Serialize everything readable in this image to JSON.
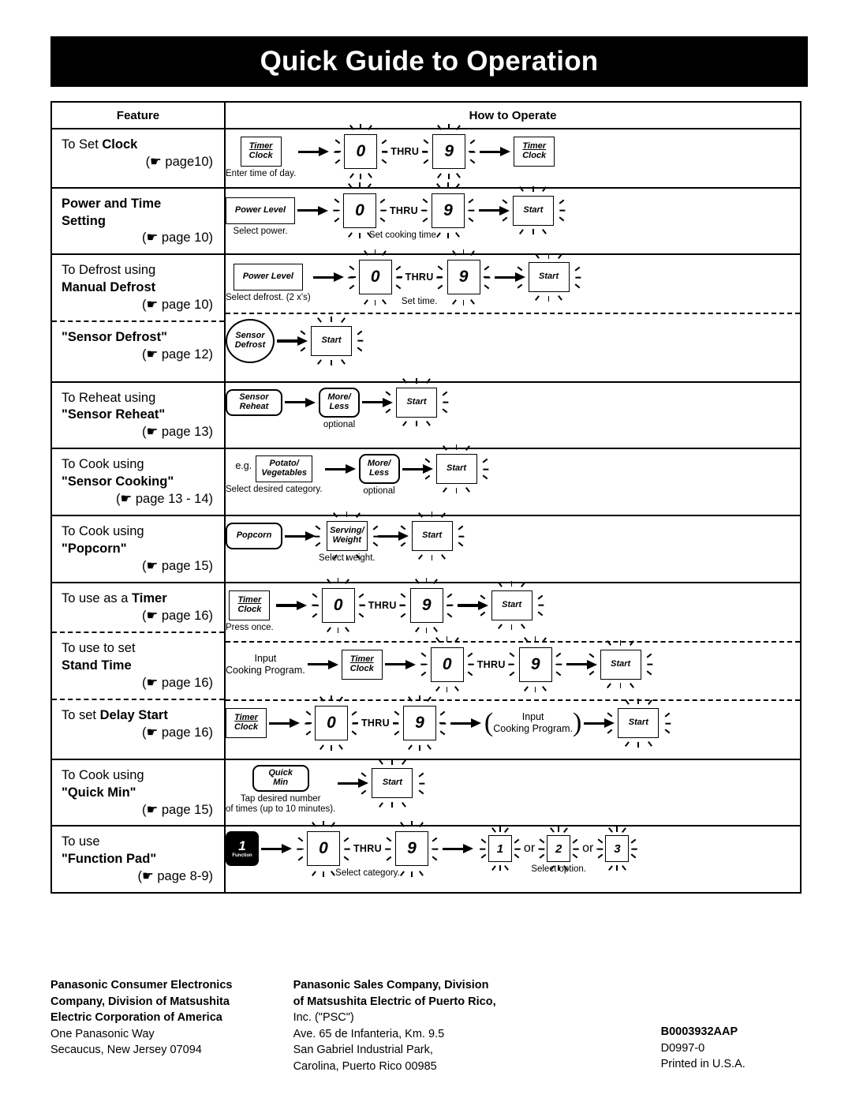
{
  "banner": {
    "title": "Quick Guide to Operation"
  },
  "table": {
    "headers": {
      "feature": "Feature",
      "how_to_operate": "How to Operate"
    },
    "labels": {
      "thru": "THRU",
      "or": "or",
      "eg": "e.g.",
      "optional": "optional"
    },
    "rows": [
      {
        "id": "set-clock",
        "feature": {
          "line1": "To Set ",
          "line1_bold": "Clock",
          "page": "(☛ page10)"
        },
        "steps": [
          {
            "type": "key",
            "label_lines": [
              "Timer",
              "Clock"
            ],
            "shape": "rect-sm",
            "underline_first": true,
            "caption": "Enter time of day."
          },
          {
            "type": "arrow"
          },
          {
            "type": "numrange",
            "from": "0",
            "to": "9",
            "caption": ""
          },
          {
            "type": "arrow"
          },
          {
            "type": "key",
            "label_lines": [
              "Timer",
              "Clock"
            ],
            "shape": "rect-sm",
            "underline_first": true,
            "caption": ""
          }
        ]
      },
      {
        "id": "power-and-time",
        "feature": {
          "line1_bold": "Power and Time",
          "line2_bold": "Setting",
          "page": "(☛ page 10)"
        },
        "steps": [
          {
            "type": "key",
            "label_lines": [
              "Power Level"
            ],
            "shape": "rect-wide",
            "caption": "Select power."
          },
          {
            "type": "arrow"
          },
          {
            "type": "numrange",
            "from": "0",
            "to": "9",
            "caption": "Set cooking time."
          },
          {
            "type": "arrow"
          },
          {
            "type": "key",
            "label_lines": [
              "Start"
            ],
            "shape": "rect-sm",
            "flashing": true,
            "caption": ""
          }
        ]
      },
      {
        "id": "manual-defrost",
        "feature": {
          "line1": "To Defrost using",
          "line2_bold": "Manual Defrost",
          "page": "(☛ page 10)"
        },
        "steps": [
          {
            "type": "key",
            "label_lines": [
              "Power Level"
            ],
            "shape": "rect-wide",
            "caption": "Select defrost. (2 x's)"
          },
          {
            "type": "arrow"
          },
          {
            "type": "numrange",
            "from": "0",
            "to": "9",
            "caption": "Set time."
          },
          {
            "type": "arrow"
          },
          {
            "type": "key",
            "label_lines": [
              "Start"
            ],
            "shape": "rect-sm",
            "flashing": true,
            "caption": ""
          }
        ]
      },
      {
        "id": "sensor-defrost",
        "feature": {
          "line1_bold": "\"Sensor Defrost\"",
          "page": "(☛ page 12)"
        },
        "steps": [
          {
            "type": "key",
            "label_lines": [
              "Sensor",
              "Defrost"
            ],
            "shape": "oval",
            "caption": ""
          },
          {
            "type": "arrow"
          },
          {
            "type": "key",
            "label_lines": [
              "Start"
            ],
            "shape": "rect-sm",
            "flashing": true,
            "caption": ""
          }
        ]
      },
      {
        "id": "sensor-reheat",
        "feature": {
          "line1": "To Reheat using",
          "line2_bold": "\"Sensor Reheat\"",
          "page": "(☛ page 13)"
        },
        "steps": [
          {
            "type": "key",
            "label_lines": [
              "Sensor",
              "Reheat"
            ],
            "shape": "rounded rect-med",
            "caption": ""
          },
          {
            "type": "arrow"
          },
          {
            "type": "key",
            "label_lines": [
              "More/",
              "Less"
            ],
            "shape": "rounded rect-sm",
            "caption": "optional"
          },
          {
            "type": "arrow"
          },
          {
            "type": "key",
            "label_lines": [
              "Start"
            ],
            "shape": "rect-sm",
            "flashing": true,
            "caption": ""
          }
        ]
      },
      {
        "id": "sensor-cooking",
        "feature": {
          "line1": "To Cook using",
          "line2_bold": "\"Sensor Cooking\"",
          "page": "(☛ page 13 - 14)"
        },
        "steps": [
          {
            "type": "key",
            "label_lines": [
              "Potato/",
              "Vegetables"
            ],
            "shape": "rect-med",
            "prefix": "e.g.",
            "caption": "Select desired category."
          },
          {
            "type": "arrow"
          },
          {
            "type": "key",
            "label_lines": [
              "More/",
              "Less"
            ],
            "shape": "rounded rect-sm",
            "caption": "optional"
          },
          {
            "type": "arrow"
          },
          {
            "type": "key",
            "label_lines": [
              "Start"
            ],
            "shape": "rect-sm",
            "flashing": true,
            "caption": ""
          }
        ]
      },
      {
        "id": "popcorn",
        "feature": {
          "line1": "To Cook using",
          "line2_bold": "\"Popcorn\"",
          "page": "(☛ page 15)"
        },
        "steps": [
          {
            "type": "key",
            "label_lines": [
              "Popcorn"
            ],
            "shape": "rounded rect-med",
            "caption": ""
          },
          {
            "type": "arrow"
          },
          {
            "type": "key",
            "label_lines": [
              "Serving/",
              "Weight"
            ],
            "shape": "rect-sm",
            "flashing": true,
            "caption": "Select weight."
          },
          {
            "type": "arrow"
          },
          {
            "type": "key",
            "label_lines": [
              "Start"
            ],
            "shape": "rect-sm",
            "flashing": true,
            "caption": ""
          }
        ]
      },
      {
        "id": "timer",
        "feature": {
          "line1": "To use as a ",
          "line1_bold": "Timer",
          "page": "(☛ page 16)"
        },
        "steps": [
          {
            "type": "key",
            "label_lines": [
              "Timer",
              "Clock"
            ],
            "shape": "rect-sm",
            "underline_first": true,
            "caption": "Press once."
          },
          {
            "type": "arrow"
          },
          {
            "type": "numrange",
            "from": "0",
            "to": "9",
            "caption": ""
          },
          {
            "type": "arrow"
          },
          {
            "type": "key",
            "label_lines": [
              "Start"
            ],
            "shape": "rect-sm",
            "flashing": true,
            "caption": ""
          }
        ]
      },
      {
        "id": "stand-time",
        "feature": {
          "line1": "To use to set",
          "line2_bold": "Stand Time",
          "page": "(☛ page 16)"
        },
        "steps": [
          {
            "type": "text",
            "text_lines": [
              "Input",
              "Cooking Program."
            ]
          },
          {
            "type": "arrow"
          },
          {
            "type": "key",
            "label_lines": [
              "Timer",
              "Clock"
            ],
            "shape": "rect-sm",
            "underline_first": true,
            "caption": ""
          },
          {
            "type": "arrow"
          },
          {
            "type": "numrange",
            "from": "0",
            "to": "9",
            "caption": ""
          },
          {
            "type": "arrow"
          },
          {
            "type": "key",
            "label_lines": [
              "Start"
            ],
            "shape": "rect-sm",
            "flashing": true,
            "caption": ""
          }
        ]
      },
      {
        "id": "delay-start",
        "feature": {
          "line1": "To set ",
          "line1_bold": "Delay Start",
          "page": "(☛ page 16)"
        },
        "steps": [
          {
            "type": "key",
            "label_lines": [
              "Timer",
              "Clock"
            ],
            "shape": "rect-sm",
            "underline_first": true,
            "caption": ""
          },
          {
            "type": "arrow"
          },
          {
            "type": "numrange",
            "from": "0",
            "to": "9",
            "caption": ""
          },
          {
            "type": "arrow"
          },
          {
            "type": "paren-text",
            "text_lines": [
              "Input",
              "Cooking Program."
            ]
          },
          {
            "type": "arrow"
          },
          {
            "type": "key",
            "label_lines": [
              "Start"
            ],
            "shape": "rect-sm",
            "flashing": true,
            "caption": ""
          }
        ]
      },
      {
        "id": "quick-min",
        "feature": {
          "line1": "To Cook using",
          "line2_bold": "\"Quick Min\"",
          "page": "(☛ page 15)"
        },
        "steps": [
          {
            "type": "key",
            "label_lines": [
              "Quick",
              "Min"
            ],
            "shape": "rounded rect-med",
            "caption_lines": [
              "Tap desired number",
              "of times (up to 10 minutes)."
            ]
          },
          {
            "type": "arrow"
          },
          {
            "type": "key",
            "label_lines": [
              "Start"
            ],
            "shape": "rect-sm",
            "flashing": true,
            "caption": ""
          }
        ]
      },
      {
        "id": "function-pad",
        "feature": {
          "line1": "To use",
          "line2_bold": "\"Function Pad\"",
          "page": "(☛ page 8-9)"
        },
        "steps": [
          {
            "type": "fnpad",
            "glyph": "1",
            "label": "Function",
            "caption": ""
          },
          {
            "type": "arrow"
          },
          {
            "type": "numrange",
            "from": "0",
            "to": "9",
            "caption": "Select category."
          },
          {
            "type": "arrow"
          },
          {
            "type": "optionkeys",
            "options": [
              "1",
              "2",
              "3"
            ],
            "caption": "Select option."
          }
        ]
      }
    ]
  },
  "footer": {
    "col1": [
      {
        "text": "Panasonic Consumer Electronics",
        "bold": true
      },
      {
        "text": "Company, Division of Matsushita",
        "bold": true
      },
      {
        "text": "Electric Corporation of America",
        "bold": true
      },
      {
        "text": "One Panasonic Way",
        "bold": false
      },
      {
        "text": "Secaucus, New Jersey 07094",
        "bold": false
      }
    ],
    "col2": [
      {
        "text": "Panasonic Sales Company, Division",
        "bold": true
      },
      {
        "text": "of Matsushita Electric of Puerto Rico,",
        "bold": true
      },
      {
        "text": "Inc. (\"PSC\")",
        "bold": false
      },
      {
        "text": "Ave. 65 de Infanteria, Km. 9.5",
        "bold": false
      },
      {
        "text": "San Gabriel Industrial Park,",
        "bold": false
      },
      {
        "text": "Carolina, Puerto Rico 00985",
        "bold": false
      }
    ],
    "col3": [
      {
        "text": "B0003932AAP",
        "bold": true
      },
      {
        "text": "D0997-0",
        "bold": false
      },
      {
        "text": "Printed in U.S.A.",
        "bold": false
      }
    ]
  }
}
